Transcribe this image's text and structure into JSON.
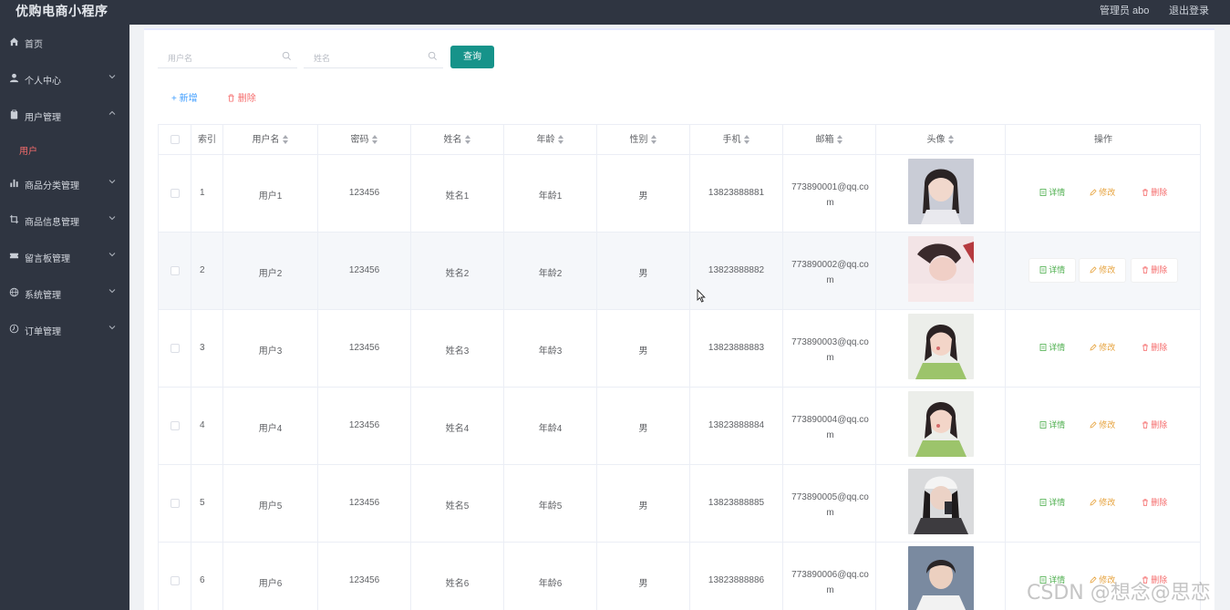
{
  "app": {
    "title": "优购电商小程序",
    "admin_label": "管理员 abo",
    "logout_label": "退出登录"
  },
  "sidebar": {
    "items": [
      {
        "label": "首页",
        "icon": "home-icon"
      },
      {
        "label": "个人中心",
        "icon": "user-icon"
      },
      {
        "label": "用户管理",
        "icon": "clipboard-icon"
      },
      {
        "label": "商品分类管理",
        "icon": "bar-chart-icon"
      },
      {
        "label": "商品信息管理",
        "icon": "crop-icon"
      },
      {
        "label": "留言板管理",
        "icon": "ticket-icon"
      },
      {
        "label": "系统管理",
        "icon": "globe-icon"
      },
      {
        "label": "订单管理",
        "icon": "clock-icon"
      }
    ],
    "active_sub": "用户"
  },
  "search": {
    "username_placeholder": "用户名",
    "name_placeholder": "姓名",
    "query_label": "查询"
  },
  "actions": {
    "add_label": "+ 新增",
    "delete_label": "删除"
  },
  "table": {
    "headers": [
      "索引",
      "用户名",
      "密码",
      "姓名",
      "年龄",
      "性别",
      "手机",
      "邮箱",
      "头像",
      "操作"
    ],
    "op_labels": {
      "detail": "详情",
      "edit": "修改",
      "remove": "删除"
    },
    "rows": [
      {
        "index": "1",
        "username": "用户1",
        "password": "123456",
        "name": "姓名1",
        "age": "年龄1",
        "gender": "男",
        "phone": "13823888881",
        "email": "773890001@qq.com"
      },
      {
        "index": "2",
        "username": "用户2",
        "password": "123456",
        "name": "姓名2",
        "age": "年龄2",
        "gender": "男",
        "phone": "13823888882",
        "email": "773890002@qq.com"
      },
      {
        "index": "3",
        "username": "用户3",
        "password": "123456",
        "name": "姓名3",
        "age": "年龄3",
        "gender": "男",
        "phone": "13823888883",
        "email": "773890003@qq.com"
      },
      {
        "index": "4",
        "username": "用户4",
        "password": "123456",
        "name": "姓名4",
        "age": "年龄4",
        "gender": "男",
        "phone": "13823888884",
        "email": "773890004@qq.com"
      },
      {
        "index": "5",
        "username": "用户5",
        "password": "123456",
        "name": "姓名5",
        "age": "年龄5",
        "gender": "男",
        "phone": "13823888885",
        "email": "773890005@qq.com"
      },
      {
        "index": "6",
        "username": "用户6",
        "password": "123456",
        "name": "姓名6",
        "age": "年龄6",
        "gender": "男",
        "phone": "13823888886",
        "email": "773890006@qq.com"
      }
    ]
  },
  "watermark": "CSDN @想念@思恋",
  "colors": {
    "sidebar_bg": "#2f3541",
    "primary": "#16938a",
    "danger": "#f56c6c",
    "success": "#4cae4c",
    "warning": "#e6a23c",
    "link": "#409eff"
  }
}
